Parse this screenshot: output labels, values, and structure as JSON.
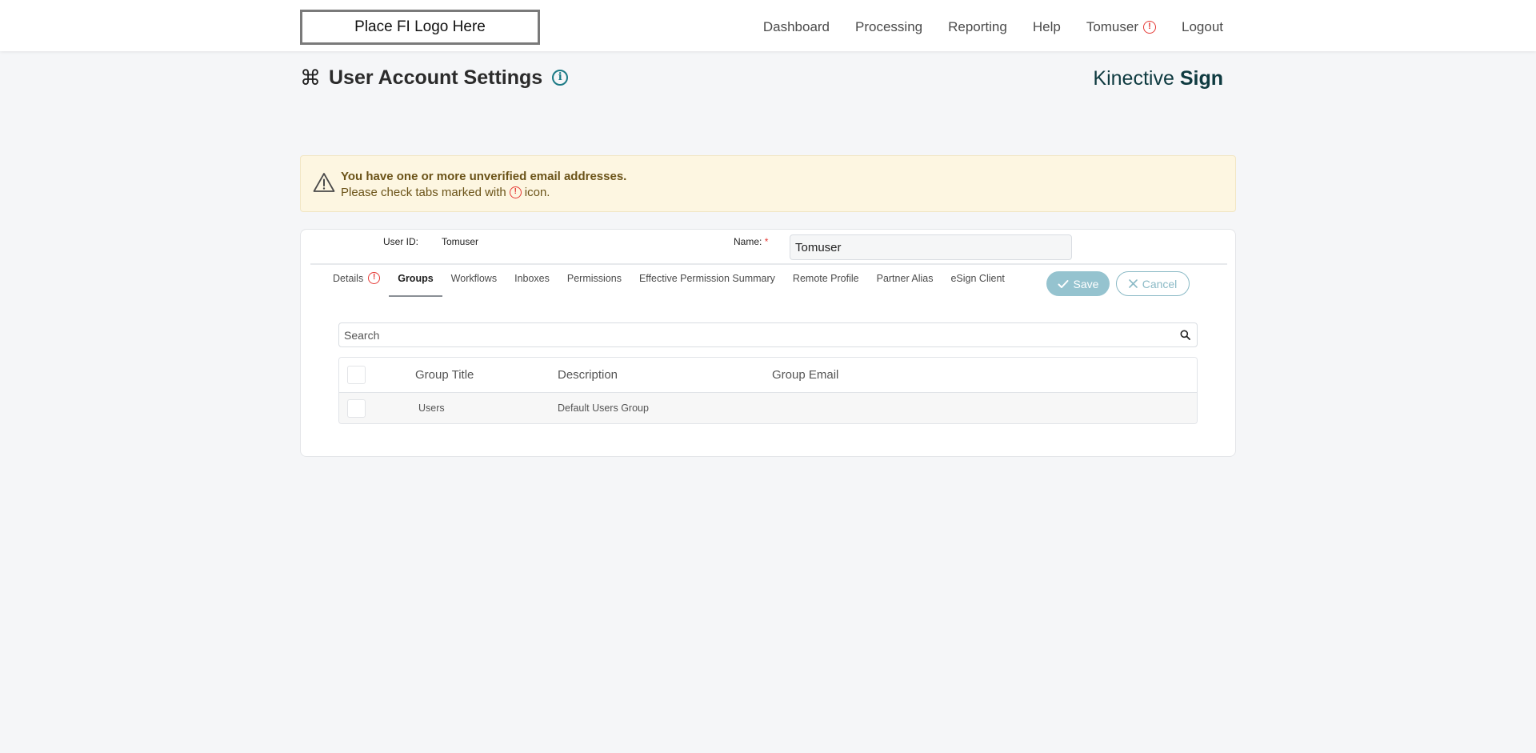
{
  "header": {
    "logo_text": "Place FI Logo Here",
    "nav": [
      "Dashboard",
      "Processing",
      "Reporting",
      "Help",
      "Tomuser",
      "Logout"
    ]
  },
  "page": {
    "title": "User Account Settings",
    "brand_light": "Kinective",
    "brand_bold": "Sign"
  },
  "banner": {
    "title": "You have one or more unverified email addresses.",
    "text_before": "Please check tabs marked with",
    "text_after": "icon."
  },
  "form": {
    "user_id_label": "User ID:",
    "user_id_value": "Tomuser",
    "name_label": "Name:",
    "name_required_mark": "*",
    "name_value": "Tomuser"
  },
  "tabs": [
    "Details",
    "Groups",
    "Workflows",
    "Inboxes",
    "Permissions",
    "Effective Permission Summary",
    "Remote Profile",
    "Partner Alias",
    "eSign Client"
  ],
  "active_tab": "Groups",
  "actions": {
    "save": "Save",
    "cancel": "Cancel"
  },
  "search": {
    "placeholder": "Search"
  },
  "table": {
    "columns": [
      "Group Title",
      "Description",
      "Group Email"
    ],
    "rows": [
      {
        "title": "Users",
        "description": "Default Users Group",
        "email": ""
      }
    ]
  },
  "colors": {
    "alert": "#e53935",
    "accent": "#1b7a85",
    "save_button": "#95c3cf",
    "banner_bg": "#fdf6e1"
  },
  "icons": {
    "alert": "exclamation-circle-icon",
    "info": "info-circle-icon",
    "warning": "warning-triangle-icon",
    "search": "search-icon",
    "check": "check-icon",
    "close": "close-icon",
    "command": "command-icon"
  }
}
